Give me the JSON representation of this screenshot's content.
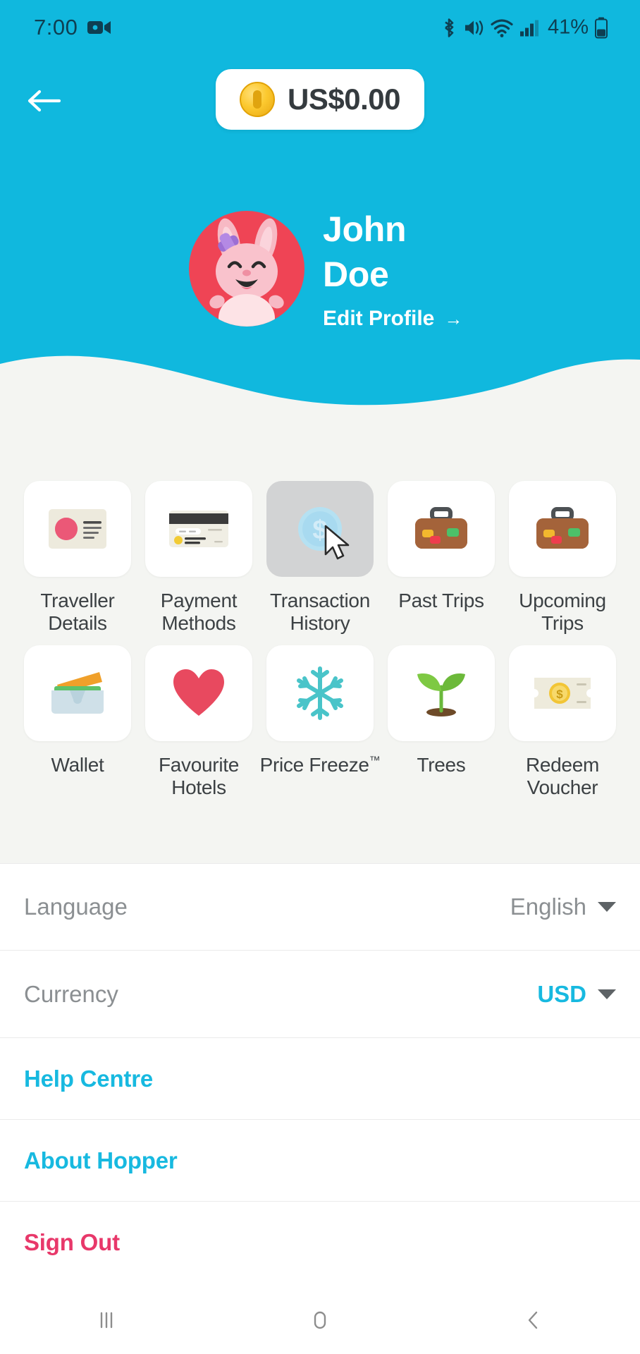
{
  "status_bar": {
    "time": "7:00",
    "battery_percent": "41%",
    "icons": [
      "video-camera-icon",
      "bluetooth-icon",
      "vibrate-icon",
      "wifi-icon",
      "signal-icon",
      "battery-icon"
    ]
  },
  "top_bar": {
    "back_icon": "arrow-left-icon",
    "balance": "US$0.00",
    "coin_icon": "coin-icon"
  },
  "profile": {
    "first_name": "John",
    "last_name": "Doe",
    "edit_label": "Edit Profile",
    "edit_arrow": "→",
    "avatar_icon": "bunny-avatar",
    "avatar_bg": "#ef4455"
  },
  "grid": {
    "rows": [
      [
        {
          "label": "Traveller Details",
          "icon": "id-card-icon",
          "pressed": false
        },
        {
          "label": "Payment Methods",
          "icon": "credit-card-icon",
          "pressed": false
        },
        {
          "label": "Transaction History",
          "icon": "dollar-coin-icon",
          "pressed": true
        },
        {
          "label": "Past Trips",
          "icon": "suitcase-icon",
          "pressed": false
        },
        {
          "label": "Upcoming Trips",
          "icon": "suitcase-icon",
          "pressed": false
        }
      ],
      [
        {
          "label": "Wallet",
          "icon": "wallet-icon",
          "pressed": false
        },
        {
          "label": "Favourite Hotels",
          "icon": "heart-icon",
          "pressed": false
        },
        {
          "label": "Price Freeze",
          "trademark": "™",
          "icon": "snowflake-icon",
          "pressed": false
        },
        {
          "label": "Trees",
          "icon": "seedling-icon",
          "pressed": false
        },
        {
          "label": "Redeem Voucher",
          "icon": "voucher-icon",
          "pressed": false
        }
      ]
    ]
  },
  "settings": {
    "language": {
      "label": "Language",
      "value": "English"
    },
    "currency": {
      "label": "Currency",
      "value": "USD"
    }
  },
  "links": [
    {
      "label": "Help Centre",
      "style": "accent"
    },
    {
      "label": "About Hopper",
      "style": "accent"
    },
    {
      "label": "Sign Out",
      "style": "danger"
    }
  ],
  "nav_bar": {
    "recents_icon": "recents-icon",
    "home_icon": "home-icon",
    "back_icon": "back-chevron-icon"
  },
  "colors": {
    "brand_cyan": "#10b8de",
    "link_cyan": "#17b9e0",
    "danger_pink": "#e8386a",
    "grid_bg": "#f4f5f2",
    "text_dark": "#3c4144",
    "text_muted": "#8b8f92"
  }
}
